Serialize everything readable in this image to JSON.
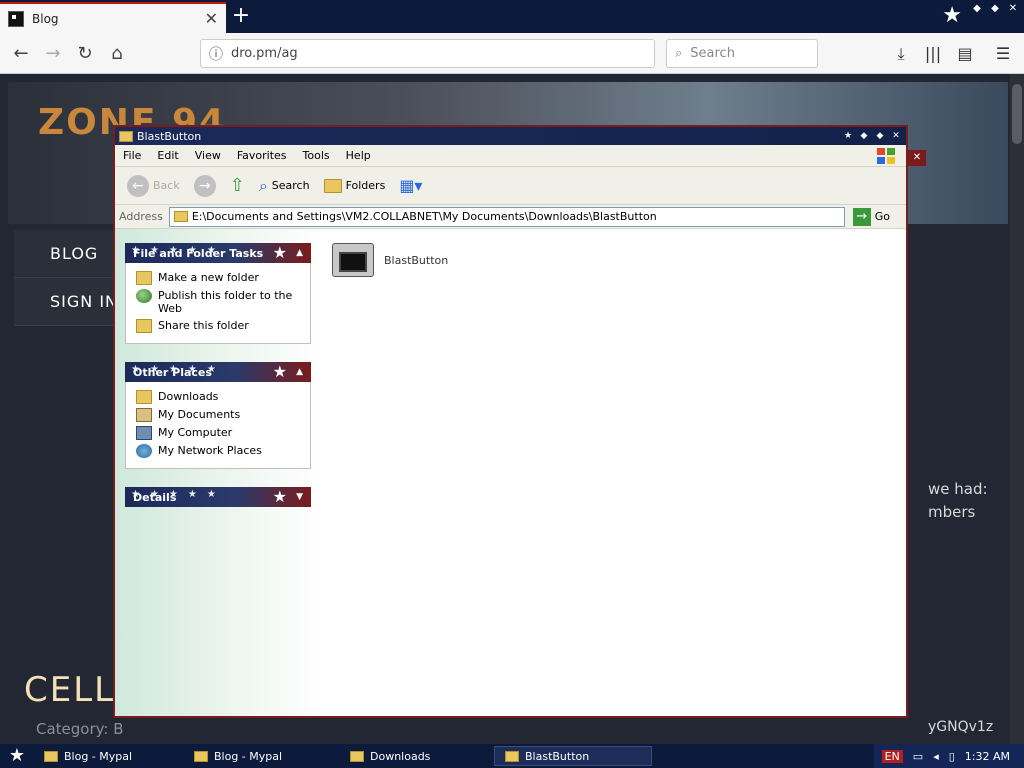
{
  "browser": {
    "tab_title": "Blog",
    "tab_close": "✕",
    "newtab": "+",
    "url": "dro.pm/ag",
    "search_placeholder": "Search"
  },
  "webpage": {
    "logo": "ZONE 94",
    "nav": [
      "BLOG",
      "SIGN IN"
    ],
    "heading": "CELLO",
    "category_label": "Category: B",
    "side_lines": [
      "we had:",
      "mbers"
    ],
    "side_code": "yGNQv1z"
  },
  "explorer": {
    "title": "BlastButton",
    "menu": [
      "File",
      "Edit",
      "View",
      "Favorites",
      "Tools",
      "Help"
    ],
    "toolbar": {
      "back": "Back",
      "search": "Search",
      "folders": "Folders"
    },
    "address_label": "Address",
    "address": "E:\\Documents and Settings\\VM2.COLLABNET\\My Documents\\Downloads\\BlastButton",
    "go": "Go",
    "panels": [
      {
        "title": "File and Folder Tasks",
        "items": [
          "Make a new folder",
          "Publish this folder to the Web",
          "Share this folder"
        ]
      },
      {
        "title": "Other Places",
        "items": [
          "Downloads",
          "My Documents",
          "My Computer",
          "My Network Places"
        ]
      },
      {
        "title": "Details",
        "items": []
      }
    ],
    "file": "BlastButton"
  },
  "taskbar": {
    "items": [
      "Blog - Mypal",
      "Blog - Mypal",
      "Downloads",
      "BlastButton"
    ],
    "lang": "EN",
    "time": "1:32 AM"
  }
}
